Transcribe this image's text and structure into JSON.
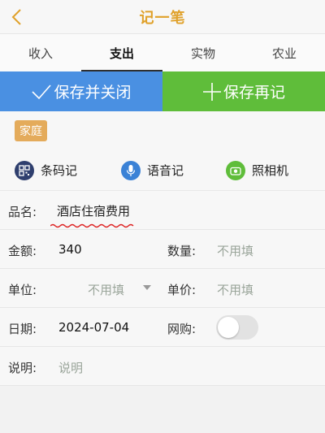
{
  "header": {
    "title": "记一笔",
    "back_icon": "chevron-left-icon"
  },
  "tabs": [
    {
      "label": "收入",
      "active": false
    },
    {
      "label": "支出",
      "active": true
    },
    {
      "label": "实物",
      "active": false
    },
    {
      "label": "农业",
      "active": false
    }
  ],
  "actions": {
    "save_close_label": "保存并关闭",
    "save_again_label": "保存再记"
  },
  "category": {
    "tag": "家庭"
  },
  "quick": {
    "barcode_label": "条码记",
    "voice_label": "语音记",
    "camera_label": "照相机"
  },
  "form": {
    "name_label": "品名:",
    "name_value": "酒店住宿费用",
    "amount_label": "金额:",
    "amount_value": "340",
    "quantity_label": "数量:",
    "quantity_placeholder": "不用填",
    "unit_label": "单位:",
    "unit_placeholder": "不用填",
    "price_label": "单价:",
    "price_placeholder": "不用填",
    "date_label": "日期:",
    "date_value": "2024-07-04",
    "online_label": "网购:",
    "online_on": false,
    "note_label": "说明:",
    "note_placeholder": "说明"
  },
  "colors": {
    "title": "#e0a12a",
    "save_close": "#4a90e2",
    "save_again": "#5fbd3a",
    "tag": "#e4ab5b",
    "barcode_icon": "#2f3f6e",
    "voice_icon": "#3b82d6",
    "camera_icon": "#5fbd3a"
  }
}
